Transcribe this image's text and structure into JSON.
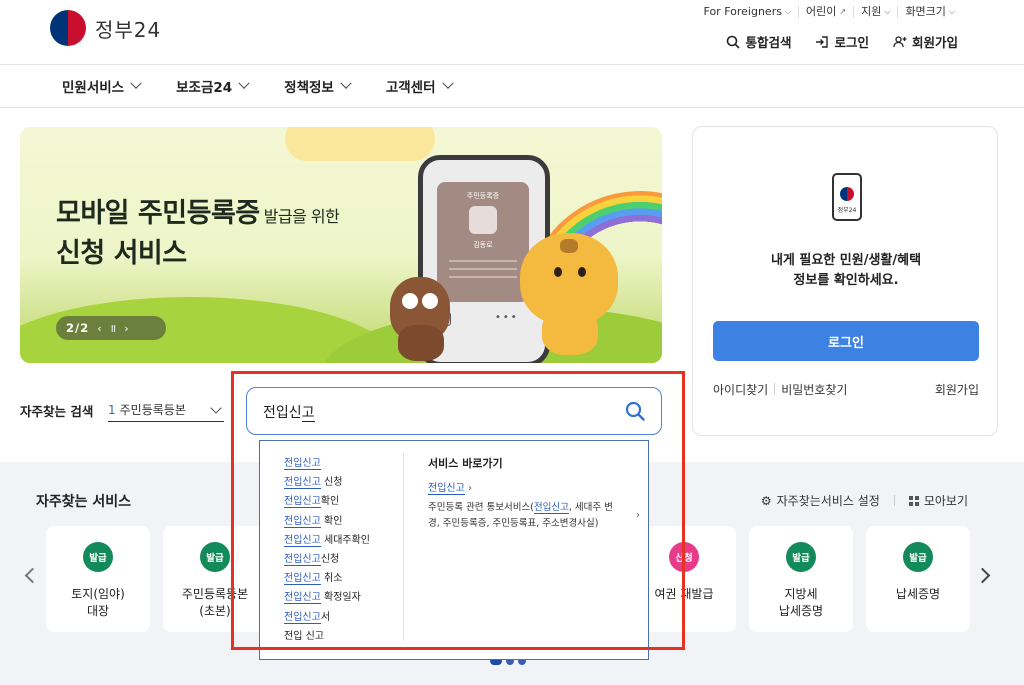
{
  "header": {
    "logo_text": "정부24",
    "util_top": [
      "For Foreigners",
      "어린이",
      "지원",
      "화면크기"
    ],
    "util_main": [
      "통합검색",
      "로그인",
      "회원가입"
    ]
  },
  "nav": [
    "민원서비스",
    "보조금24",
    "정책정보",
    "고객센터"
  ],
  "banner": {
    "title_line1": "모바일 주민등록증",
    "title_small": "발급을 위한",
    "title_line2": "신청 서비스",
    "card_label": "주민등록증",
    "card_name": "김동로",
    "counter": "2/2"
  },
  "login_card": {
    "phone_label": "정부24",
    "message_line1": "내게 필요한 민원/생활/혜택",
    "message_line2": "정보를 확인하세요.",
    "login_button": "로그인",
    "find_id": "아이디찾기",
    "find_pw": "비밀번호찾기",
    "signup": "회원가입"
  },
  "frequent_search": {
    "label": "자주찾는 검색",
    "rank": "1",
    "keyword": "주민등록등본"
  },
  "search": {
    "value_prefix": "전입신",
    "value_underlined": "고"
  },
  "autocomplete": {
    "suggestions": [
      {
        "hl": "전입신고",
        "rest": ""
      },
      {
        "hl": "전입신고",
        "rest": " 신청"
      },
      {
        "hl": "전입신고",
        "rest": "확인"
      },
      {
        "hl": "전입신고",
        "rest": " 확인"
      },
      {
        "hl": "전입신고",
        "rest": " 세대주확인"
      },
      {
        "hl": "전입신고",
        "rest": "신청"
      },
      {
        "hl": "전입신고",
        "rest": " 취소"
      },
      {
        "hl": "전입신고",
        "rest": " 확정일자"
      },
      {
        "hl": "전입신고",
        "rest": "서"
      },
      {
        "hl": "",
        "rest": "전입 신고"
      }
    ],
    "shortcut_title": "서비스 바로가기",
    "shortcut_link": "전입신고",
    "shortcut_desc_pre": "주민등록 관련 통보서비스(",
    "shortcut_desc_hl": "전입신고",
    "shortcut_desc_post": ", 세대주 변경, 주민등록증, 주민등록표, 주소변경사실)"
  },
  "services": {
    "title": "자주찾는 서비스",
    "settings": "자주찾는서비스 설정",
    "collect": "모아보기",
    "cards": [
      {
        "badge": "발급",
        "name": "토지(임야)\n대장",
        "color": "#138a5a"
      },
      {
        "badge": "발급",
        "name": "주민등록등본\n(초본)",
        "color": "#138a5a"
      },
      {
        "badge": "신청",
        "name": "여권 재발급",
        "color": "#e83c8a"
      },
      {
        "badge": "발급",
        "name": "지방세\n납세증명",
        "color": "#138a5a"
      },
      {
        "badge": "발급",
        "name": "납세증명",
        "color": "#138a5a"
      }
    ]
  }
}
